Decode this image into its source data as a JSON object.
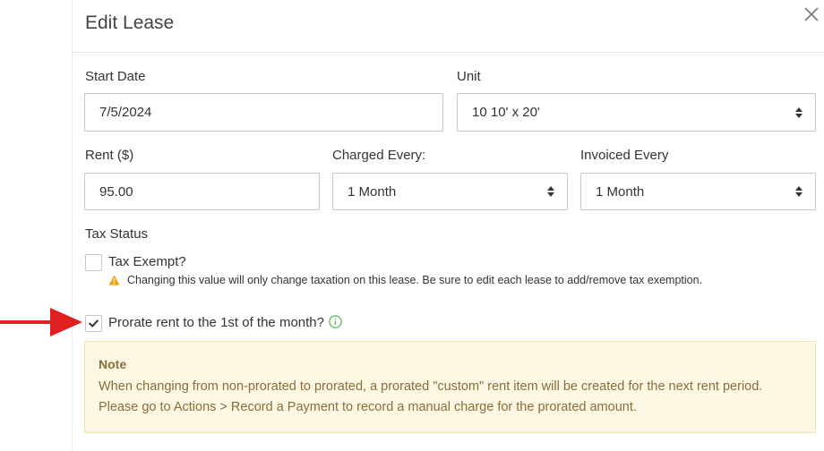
{
  "dialog": {
    "title": "Edit Lease"
  },
  "form": {
    "start_date": {
      "label": "Start Date",
      "value": "7/5/2024"
    },
    "unit": {
      "label": "Unit",
      "value": "10 10' x 20'"
    },
    "rent": {
      "label": "Rent ($)",
      "value": "95.00"
    },
    "charged_every": {
      "label": "Charged Every:",
      "value": "1 Month"
    },
    "invoiced_every": {
      "label": "Invoiced Every",
      "value": "1 Month"
    },
    "tax_status": {
      "label": "Tax Status",
      "tax_exempt_label": "Tax Exempt?",
      "tax_exempt_checked": false,
      "warning": "Changing this value will only change taxation on this lease. Be sure to edit each lease to add/remove tax exemption."
    },
    "prorate": {
      "label": "Prorate rent to the 1st of the month?",
      "checked": true
    }
  },
  "note": {
    "title": "Note",
    "line1": "When changing from non-prorated to prorated, a prorated \"custom\" rent item will be created for the next rent period.",
    "line2": "Please go to Actions > Record a Payment to record a manual charge for the prorated amount."
  },
  "colors": {
    "warning_icon": "#f0a30a",
    "info_icon": "#5cb85c",
    "annotation_arrow": "#e02020",
    "note_background": "#fcf8e3",
    "note_text": "#8a6d3b"
  },
  "icons": {
    "close": "close-icon",
    "select": "select-arrows-icon",
    "warning": "warning-triangle-icon",
    "info": "info-circle-icon",
    "check": "checkmark-icon",
    "annotation": "red-arrow-annotation"
  }
}
